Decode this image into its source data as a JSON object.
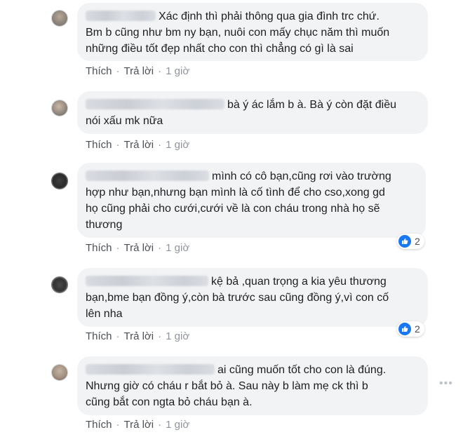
{
  "actions": {
    "like": "Thích",
    "reply": "Trả lời",
    "separator": "·"
  },
  "comments": [
    {
      "author_visible": "Xác định thì phải thông qua gia đình trc chứ.",
      "lines": [
        "Bm b cũng như bm ny bạn, nuôi con mấy chục năm thì muốn",
        "những điều tốt đẹp nhất cho con thì chẳng có gì là sai"
      ],
      "time": "1 giờ"
    },
    {
      "author_visible": "bà ý ác lắm b à. Bà ý còn đặt điều",
      "lines": [
        "nói xấu mk nữa"
      ],
      "time": "1 giờ"
    },
    {
      "author_visible": "mình có cô bạn,cũng rơi vào trường",
      "lines": [
        "hợp như bạn,nhưng bạn mình là cố tình để cho cso,xong gd",
        "họ cũng phải cho cưới,cưới về là con cháu trong nhà họ sẽ",
        "thương"
      ],
      "time": "1 giờ",
      "reactions": "2"
    },
    {
      "author_visible": "kệ bả ,quan trọng a kia yêu thương",
      "lines": [
        "bạn,bme bạn đồng ý,còn bà trước sau cũng đồng ý,vì con cố",
        "lên nha"
      ],
      "time": "1 giờ",
      "reactions": "2"
    },
    {
      "author_visible": "ai cũng muốn tốt cho con là đúng.",
      "lines": [
        "Nhưng giờ có cháu r bắt bỏ à. Sau này b làm mẹ ck thì b",
        "cũng bắt con ngta bỏ cháu bạn à."
      ],
      "time": "1 giờ"
    }
  ],
  "colors": {
    "bubble": "#f2f3f5",
    "like_blue": "#1877f2",
    "meta_gray": "#90949c"
  },
  "icons": {
    "more": "more-horizontal-icon",
    "like": "thumbs-up-icon"
  }
}
